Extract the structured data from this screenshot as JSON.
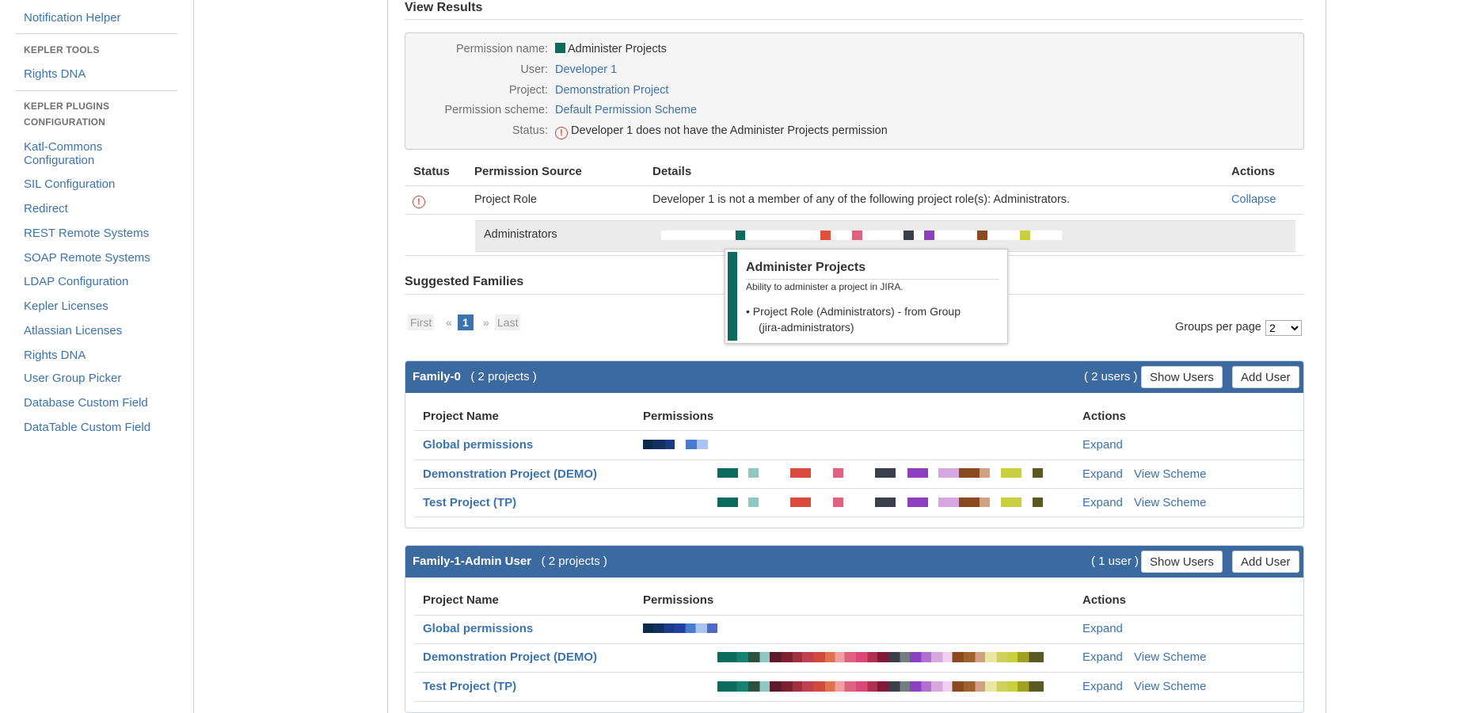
{
  "sidebar": {
    "items_top": [
      {
        "label": "Notification Helper"
      }
    ],
    "kepler_tools": {
      "heading": "KEPLER TOOLS",
      "items": [
        {
          "label": "Rights DNA"
        }
      ]
    },
    "kepler_plugins": {
      "heading_line1": "KEPLER PLUGINS",
      "heading_line2": "CONFIGURATION",
      "items": [
        {
          "label": "Katl-Commons",
          "label2": "Configuration"
        },
        {
          "label": "SIL Configuration"
        },
        {
          "label": "Redirect"
        },
        {
          "label": "REST Remote Systems"
        },
        {
          "label": "SOAP Remote Systems"
        },
        {
          "label": "LDAP Configuration"
        },
        {
          "label": "Kepler Licenses"
        },
        {
          "label": "Atlassian Licenses"
        },
        {
          "label": "Rights DNA"
        },
        {
          "label": "User Group Picker"
        },
        {
          "label": "Database Custom Field"
        },
        {
          "label": "DataTable Custom Field"
        }
      ]
    }
  },
  "view_results": {
    "title": "View Results",
    "permission_name_label": "Permission name:",
    "permission_name": "Administer Projects",
    "permission_color": "#0c6b5e",
    "user_label": "User:",
    "user": "Developer 1",
    "project_label": "Project:",
    "project": "Demonstration Project",
    "scheme_label": "Permission scheme:",
    "scheme": "Default Permission Scheme",
    "status_label": "Status:",
    "status": "Developer 1 does not have the Administer Projects permission"
  },
  "source_table": {
    "headers": {
      "status": "Status",
      "source": "Permission Source",
      "details": "Details",
      "actions": "Actions"
    },
    "row": {
      "source": "Project Role",
      "details": "Developer 1 is not a member of any of the following project role(s): Administrators.",
      "action": "Collapse"
    },
    "sub_row": {
      "role": "Administrators",
      "colors": [
        "#0c6b5e",
        "#e0503a",
        "#e06080",
        "#3a3f4a",
        "#8e3fbf",
        "#8a4a20",
        "#c8d040"
      ]
    }
  },
  "tooltip": {
    "title": "Administer Projects",
    "description": "Ability to administer a project in JIRA.",
    "bullet_line1": "Project Role (Administrators) - from Group",
    "bullet_line2": "(jira-administrators)"
  },
  "suggested": {
    "title": "Suggested Families",
    "pagination": {
      "first": "First",
      "prev": "«",
      "current": "1",
      "next": "»",
      "last": "Last"
    },
    "groups_per_page_label": "Groups per page",
    "groups_per_page_value": "2"
  },
  "families": [
    {
      "name": "Family-0",
      "projects_count": "( 2 projects )",
      "users_count": "( 2 users )",
      "show_users": "Show Users",
      "add_user": "Add User",
      "headers": {
        "project": "Project Name",
        "permissions": "Permissions",
        "actions": "Actions"
      },
      "rows": [
        {
          "name": "Global permissions",
          "expand": "Expand",
          "view_scheme": ""
        },
        {
          "name": "Demonstration Project (DEMO)",
          "expand": "Expand",
          "view_scheme": "View Scheme"
        },
        {
          "name": "Test Project (TP)",
          "expand": "Expand",
          "view_scheme": "View Scheme"
        }
      ]
    },
    {
      "name": "Family-1-Admin User",
      "projects_count": "( 2 projects )",
      "users_count": "( 1 user )",
      "show_users": "Show Users",
      "add_user": "Add User",
      "headers": {
        "project": "Project Name",
        "permissions": "Permissions",
        "actions": "Actions"
      },
      "rows": [
        {
          "name": "Global permissions",
          "expand": "Expand",
          "view_scheme": ""
        },
        {
          "name": "Demonstration Project (DEMO)",
          "expand": "Expand",
          "view_scheme": "View Scheme"
        },
        {
          "name": "Test Project (TP)",
          "expand": "Expand",
          "view_scheme": "View Scheme"
        }
      ]
    }
  ]
}
